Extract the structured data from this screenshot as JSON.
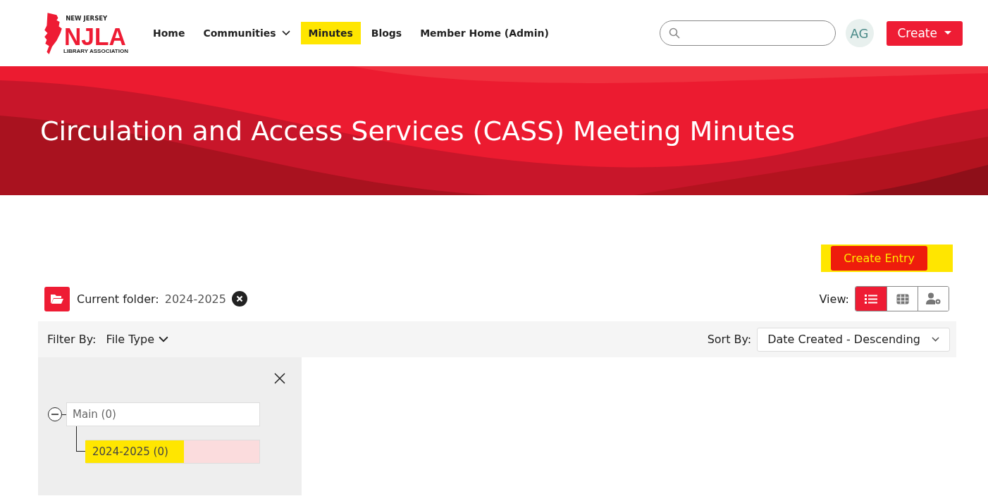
{
  "logo": {
    "top": "NEW JERSEY",
    "main": "NJLA",
    "bottom": "LIBRARY ASSOCIATION"
  },
  "nav": [
    {
      "label": "Home",
      "dropdown": false,
      "highlighted": false
    },
    {
      "label": "Communities",
      "dropdown": true,
      "highlighted": false
    },
    {
      "label": "Minutes",
      "dropdown": false,
      "highlighted": true
    },
    {
      "label": "Blogs",
      "dropdown": false,
      "highlighted": false
    },
    {
      "label": "Member Home (Admin)",
      "dropdown": false,
      "highlighted": false
    }
  ],
  "avatar": "AG",
  "create_button": "Create",
  "banner": {
    "title": "Circulation and Access Services (CASS) Meeting Minutes"
  },
  "create_entry": {
    "label": "Create Entry",
    "highlighted": true
  },
  "current_folder": {
    "label": "Current folder:",
    "value": "2024-2025"
  },
  "view": {
    "label": "View:",
    "options": [
      {
        "kind": "list",
        "selected": true
      },
      {
        "kind": "grid",
        "selected": false
      },
      {
        "kind": "permissions",
        "selected": false
      }
    ]
  },
  "filter": {
    "label": "Filter By:",
    "value": "File Type"
  },
  "sort": {
    "label": "Sort By:",
    "value": "Date Created - Descending"
  },
  "tree": [
    {
      "label": "Main (0)",
      "selected": false,
      "highlighted": false,
      "expanded": true,
      "children": [
        {
          "label": "2024-2025 (0)",
          "selected": true,
          "highlighted": true
        }
      ]
    }
  ]
}
